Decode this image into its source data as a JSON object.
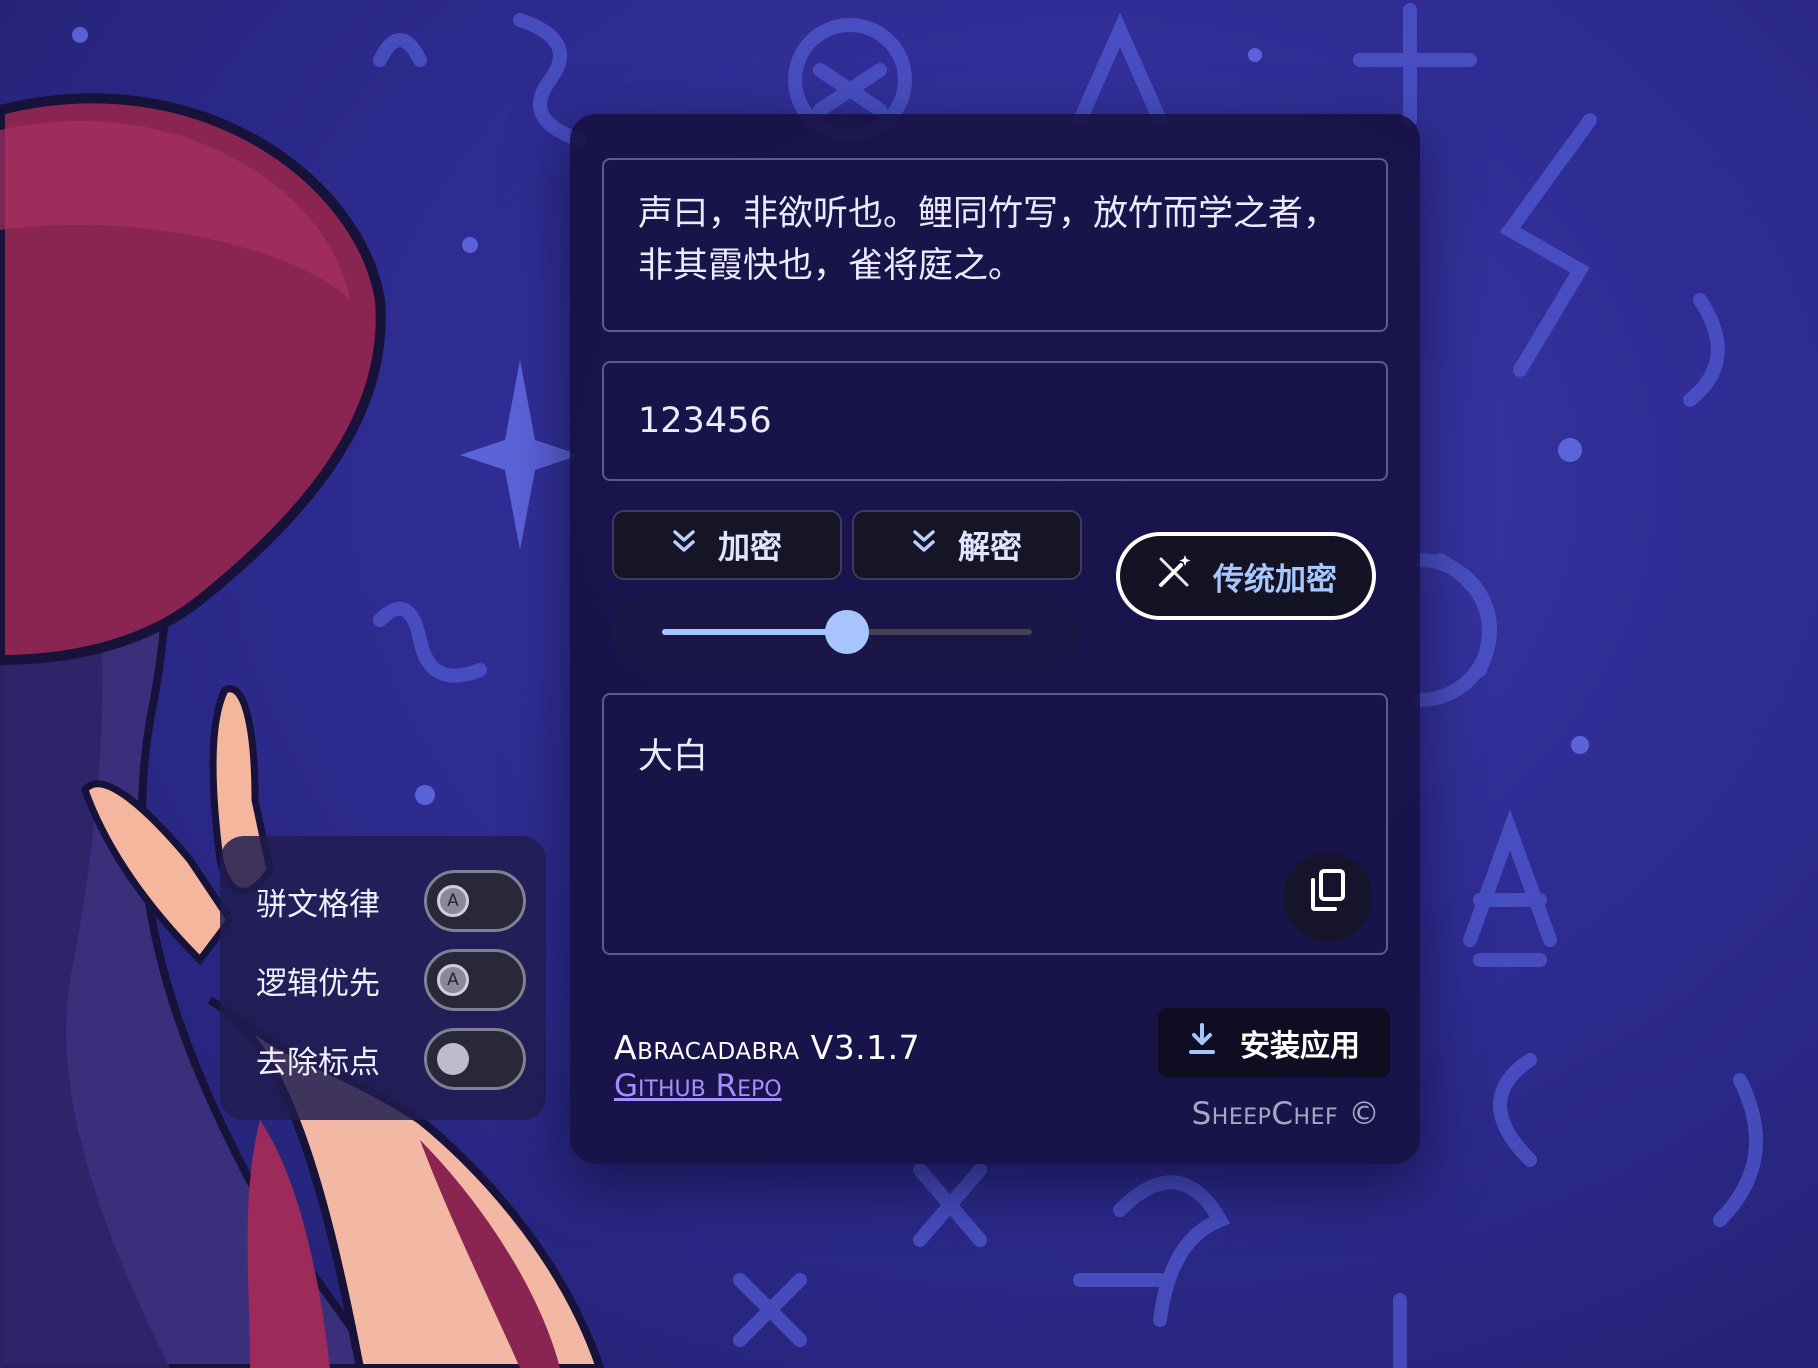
{
  "main": {
    "input_text": "声曰，非欲听也。鲤同竹写，放竹而学之者，非其霞快也，雀将庭之。",
    "key_value": "123456",
    "encrypt_label": "加密",
    "decrypt_label": "解密",
    "traditional_label": "传统加密",
    "level": 0.5,
    "output_text": "大白"
  },
  "footer": {
    "app_name": "Abracadabra V3.1.7",
    "repo_link": "Github Repo",
    "install_label": "安装应用",
    "copyright": "SheepChef ©"
  },
  "options": [
    {
      "label": "骈文格律",
      "state": "auto",
      "knob_letter": "A"
    },
    {
      "label": "逻辑优先",
      "state": "auto",
      "knob_letter": "A"
    },
    {
      "label": "去除标点",
      "state": "off",
      "knob_letter": ""
    }
  ],
  "colors": {
    "background": "#2e2c92",
    "accent": "#a8c5ff",
    "link": "#a48dff"
  }
}
